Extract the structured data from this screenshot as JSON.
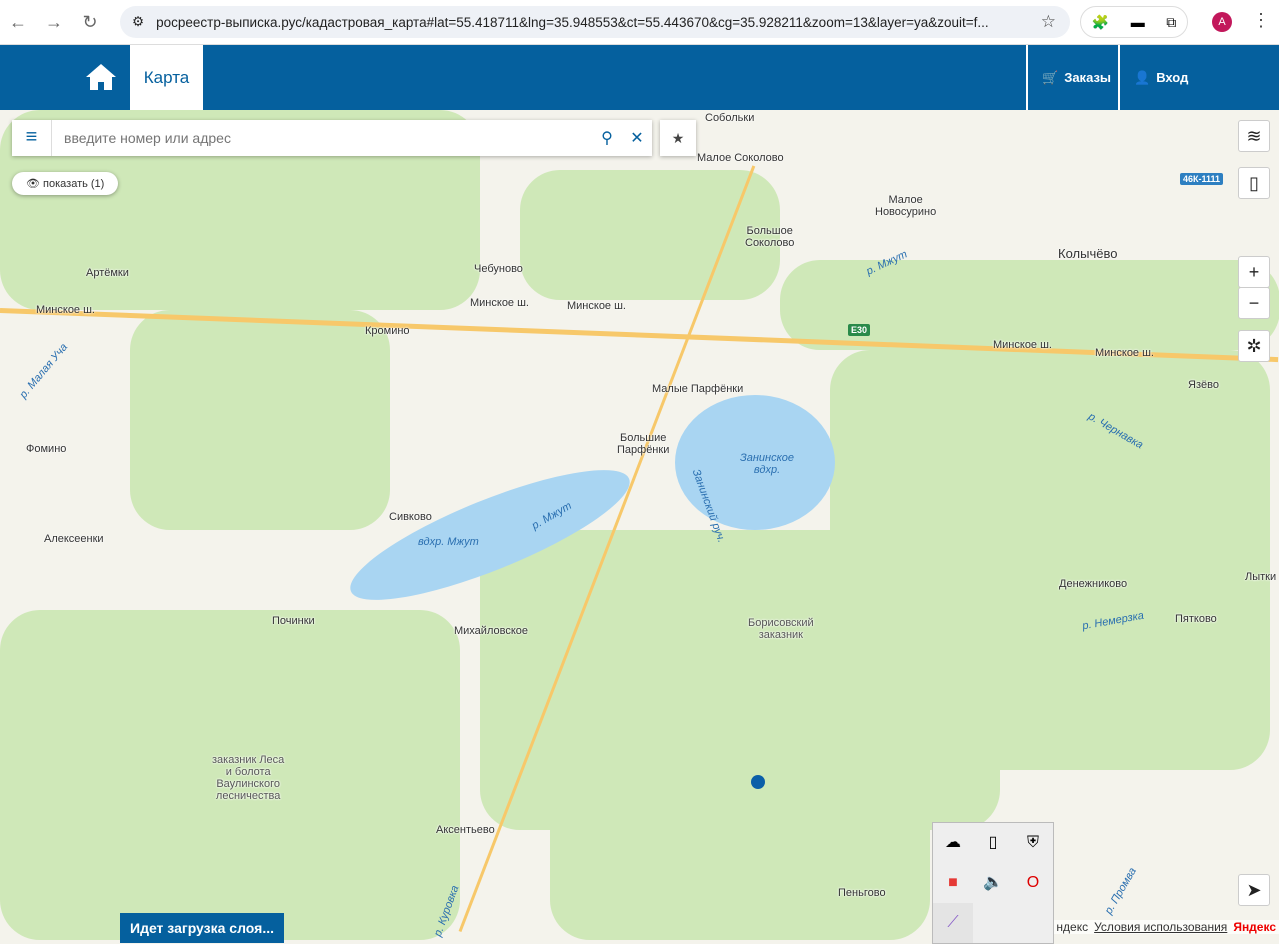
{
  "browser": {
    "url": "росреестр-выписка.рус/кадастровая_карта#lat=55.418711&lng=35.948553&ct=55.443670&cg=35.928211&zoom=13&layer=ya&zouit=f...",
    "avatar": "A"
  },
  "header": {
    "tab": "Карта",
    "orders": "Заказы",
    "login": "Вход"
  },
  "search": {
    "placeholder": "введите номер или адрес"
  },
  "show_button": "показать (1)",
  "loading": "Идет загрузка слоя...",
  "attribution": {
    "left": "ндекс",
    "terms": "Условия использования",
    "logo": "Яндекс"
  },
  "map": {
    "places": [
      "Малое Соколово",
      "Малое\nНовосурино",
      "Большое\nСоколово",
      "Собольки",
      "Колычёво",
      "Артёмки",
      "Чебуново",
      "Кромино",
      "Минское ш.",
      "Минское ш.",
      "Минское ш.",
      "Минское ш.",
      "Минское ш.",
      "Малые Парфёнки",
      "Большие\nПарфёнки",
      "Язёво",
      "Фомино",
      "Сивково",
      "Алексеенки",
      "Денежниково",
      "Пятково",
      "Лытки",
      "Починки",
      "Михайловское",
      "Борисовский\nзаказник",
      "заказник Леса\nи болота\nВаулинского\nлесничества",
      "Аксентьево",
      "Пеньгово"
    ],
    "water": [
      "Занинское\nвдхр.",
      "вдхр. Мжут",
      "р. Мжут",
      "р. Мжут",
      "р. Немерзка",
      "р. Чернавка",
      "р. Промва",
      "р. Куровка",
      "р. Малая Уча",
      "Занинский руч."
    ],
    "badges": [
      "46К-1111",
      "E30"
    ]
  }
}
